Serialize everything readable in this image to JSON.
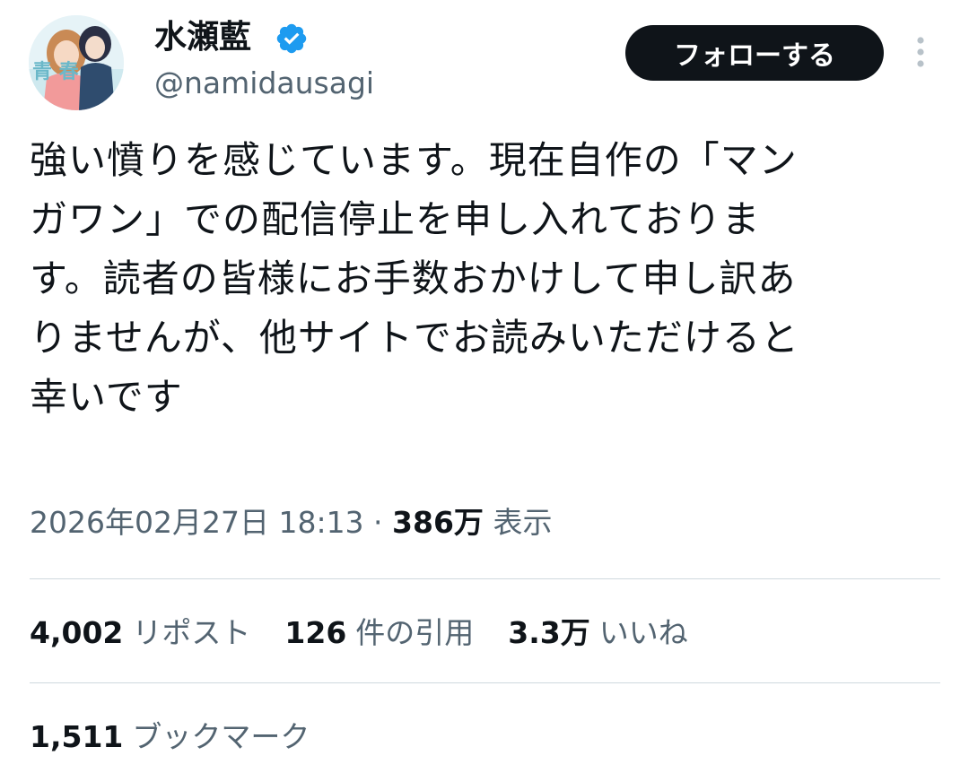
{
  "author": {
    "display_name": "水瀬藍",
    "handle": "@namidausagi",
    "verified": true,
    "avatar_text": "青 春"
  },
  "follow_button": {
    "label": "フォローする"
  },
  "tweet": {
    "text": "強い憤りを感じています。現在自作の「マン\nガワン」での配信停止を申し入れておりま\nす。読者の皆様にお手数おかけして申し訳あ\nりませんが、他サイトでお読みいただけると\n幸いです"
  },
  "meta": {
    "datetime": "2026年02月27日 18:13",
    "separator": " · ",
    "views_count": "386万",
    "views_label": "表示"
  },
  "stats": {
    "reposts": {
      "count": "4,002",
      "label": "リポスト"
    },
    "quotes": {
      "count": "126",
      "label": "件の引用"
    },
    "likes": {
      "count": "3.3万",
      "label": "いいね"
    },
    "bookmarks": {
      "count": "1,511",
      "label": "ブックマーク"
    }
  },
  "icons": {
    "verified": "verified-badge-icon",
    "more": "more-vertical-icon"
  },
  "colors": {
    "text_primary": "#0f1419",
    "text_secondary": "#536471",
    "verified_blue": "#1d9bf0",
    "follow_button_bg": "#0f1419",
    "divider": "#cfd9de"
  }
}
